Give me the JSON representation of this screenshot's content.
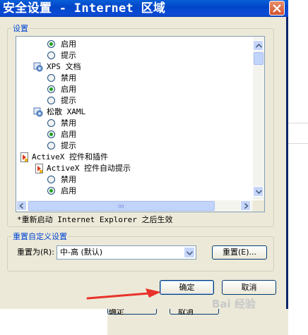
{
  "window": {
    "title": "安全设置 - Internet 区域"
  },
  "settings_group": {
    "label": "设置"
  },
  "list": {
    "rows": [
      {
        "kind": "radio",
        "text": "启用",
        "checked": true
      },
      {
        "kind": "radio",
        "text": "提示",
        "checked": false
      },
      {
        "kind": "section",
        "text": "XPS 文档",
        "icon": "gear-settings-icon"
      },
      {
        "kind": "radio",
        "text": "禁用",
        "checked": false
      },
      {
        "kind": "radio",
        "text": "启用",
        "checked": true
      },
      {
        "kind": "radio",
        "text": "提示",
        "checked": false
      },
      {
        "kind": "section",
        "text": "松散 XAML",
        "icon": "gear-settings-icon"
      },
      {
        "kind": "radio",
        "text": "禁用",
        "checked": false
      },
      {
        "kind": "radio",
        "text": "启用",
        "checked": true
      },
      {
        "kind": "radio",
        "text": "提示",
        "checked": false
      },
      {
        "kind": "category",
        "text": "ActiveX 控件和插件",
        "icon": "activex-icon"
      },
      {
        "kind": "subsection",
        "text": "ActiveX 控件自动提示",
        "icon": "activex-icon"
      },
      {
        "kind": "radio",
        "text": "禁用",
        "checked": false
      },
      {
        "kind": "radio",
        "text": "启用",
        "checked": true
      }
    ]
  },
  "note": "*重新启动 Internet Explorer 之后生效",
  "reset_group": {
    "label": "重置自定义设置",
    "reset_to_label": "重置为(R):",
    "level_value": "中-高 (默认)",
    "reset_button": "重置(E)..."
  },
  "buttons": {
    "ok": "确定",
    "cancel": "取消"
  },
  "background": {
    "lower_left": "确定",
    "lower_right": "取消",
    "watermark": "Bai 经验"
  },
  "colors": {
    "titlebar": "#0046c8",
    "check_dot": "#21a121",
    "arrow": "#e8322a"
  }
}
